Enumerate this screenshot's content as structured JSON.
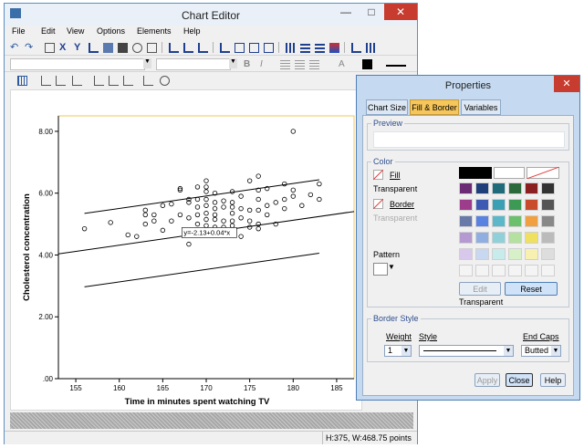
{
  "chart_editor": {
    "title": "Chart Editor",
    "menu": [
      "File",
      "Edit",
      "View",
      "Options",
      "Elements",
      "Help"
    ],
    "status": "H:375, W:468.75 points"
  },
  "chart_data": {
    "type": "scatter",
    "xlabel": "Time in minutes spent watching TV",
    "ylabel": "Cholesterol concentration",
    "xlim": [
      153,
      187
    ],
    "ylim": [
      0,
      8.5
    ],
    "x_ticks": [
      "155",
      "160",
      "165",
      "170",
      "175",
      "180",
      "185"
    ],
    "y_ticks": [
      ".00",
      "2.00",
      "4.00",
      "6.00",
      "8.00"
    ],
    "fit_label": "y=-2.13+0.04*x",
    "fit_line": {
      "intercept": -2.13,
      "slope": 0.0403
    },
    "band_offset": 0.72,
    "points": [
      [
        156,
        4.85
      ],
      [
        159,
        5.05
      ],
      [
        161,
        4.65
      ],
      [
        162,
        4.6
      ],
      [
        163,
        5.45
      ],
      [
        163,
        5.3
      ],
      [
        163,
        5.0
      ],
      [
        164,
        5.1
      ],
      [
        164,
        5.3
      ],
      [
        165,
        5.6
      ],
      [
        165,
        4.8
      ],
      [
        166,
        5.65
      ],
      [
        166,
        5.1
      ],
      [
        167,
        6.15
      ],
      [
        167,
        6.1
      ],
      [
        167,
        5.3
      ],
      [
        168,
        5.8
      ],
      [
        168,
        5.7
      ],
      [
        168,
        5.2
      ],
      [
        168,
        4.35
      ],
      [
        169,
        6.2
      ],
      [
        169,
        5.8
      ],
      [
        169,
        5.55
      ],
      [
        169,
        5.3
      ],
      [
        169,
        5.0
      ],
      [
        170,
        6.4
      ],
      [
        170,
        6.2
      ],
      [
        170,
        6.05
      ],
      [
        170,
        5.8
      ],
      [
        170,
        5.6
      ],
      [
        170,
        5.35
      ],
      [
        170,
        5.15
      ],
      [
        170,
        4.95
      ],
      [
        170,
        4.7
      ],
      [
        171,
        6.0
      ],
      [
        171,
        5.7
      ],
      [
        171,
        5.5
      ],
      [
        171,
        5.3
      ],
      [
        171,
        5.15
      ],
      [
        171,
        4.9
      ],
      [
        172,
        5.75
      ],
      [
        172,
        5.55
      ],
      [
        172,
        5.1
      ],
      [
        172,
        4.9
      ],
      [
        172,
        4.65
      ],
      [
        173,
        6.05
      ],
      [
        173,
        5.7
      ],
      [
        173,
        5.55
      ],
      [
        173,
        5.35
      ],
      [
        173,
        5.1
      ],
      [
        173,
        4.95
      ],
      [
        174,
        5.9
      ],
      [
        174,
        5.5
      ],
      [
        174,
        5.2
      ],
      [
        174,
        4.6
      ],
      [
        175,
        6.4
      ],
      [
        175,
        5.45
      ],
      [
        175,
        5.1
      ],
      [
        175,
        4.9
      ],
      [
        176,
        6.55
      ],
      [
        176,
        6.1
      ],
      [
        176,
        5.8
      ],
      [
        176,
        5.45
      ],
      [
        176,
        5.0
      ],
      [
        176,
        4.85
      ],
      [
        177,
        6.15
      ],
      [
        177,
        5.6
      ],
      [
        177,
        5.3
      ],
      [
        178,
        5.7
      ],
      [
        178,
        5.0
      ],
      [
        179,
        6.3
      ],
      [
        179,
        5.8
      ],
      [
        179,
        5.5
      ],
      [
        180,
        6.1
      ],
      [
        180,
        5.9
      ],
      [
        180,
        8.0
      ],
      [
        181,
        5.6
      ],
      [
        182,
        5.95
      ],
      [
        183,
        6.3
      ],
      [
        183,
        5.8
      ]
    ],
    "frame_color": "#f6c65b"
  },
  "properties": {
    "title": "Properties",
    "tabs": [
      "Chart Size",
      "Fill & Border",
      "Variables"
    ],
    "preview_label": "Preview",
    "color_label": "Color",
    "fill_label": "Fill",
    "fill_value": "Transparent",
    "border_label": "Border",
    "border_value": "Transparent",
    "pattern_label": "Pattern",
    "edit_button": "Edit",
    "reset_button": "Reset",
    "palette_caption": "Transparent",
    "border_style_label": "Border Style",
    "weight_label": "Weight",
    "weight_value": "1",
    "style_label": "Style",
    "endcaps_label": "End Caps",
    "endcaps_value": "Butted",
    "apply_button": "Apply",
    "close_button": "Close",
    "help_button": "Help",
    "palette": [
      "#6b2a74",
      "#1f3f7a",
      "#1f6b7a",
      "#2b6b3b",
      "#8a2020",
      "#333333",
      "#9e3c8c",
      "#3c5ab4",
      "#3ca0b4",
      "#3c9a54",
      "#c84c2c",
      "#555555",
      "#6a7aa8",
      "#5a82e0",
      "#5ab8c8",
      "#6cc06c",
      "#f0a040",
      "#888888",
      "#b49ad0",
      "#90aee0",
      "#90d0d8",
      "#b4e0a0",
      "#f0e060",
      "#bbbbbb",
      "#d8c8ec",
      "#c8d8f0",
      "#c8ecec",
      "#d8f0c8",
      "#f8f0b0",
      "#dddddd"
    ]
  }
}
